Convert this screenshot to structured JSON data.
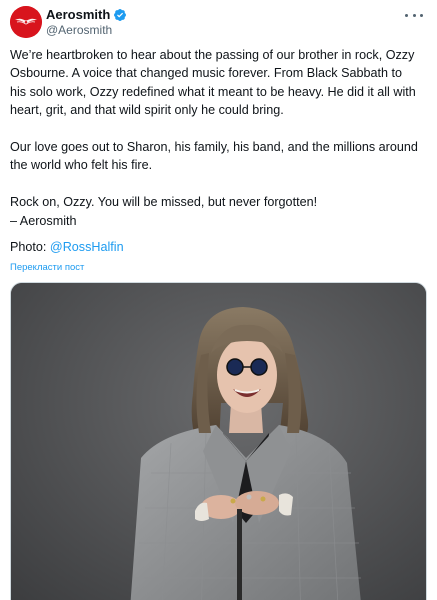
{
  "author": {
    "display_name": "Aerosmith",
    "handle": "@Aerosmith",
    "verified_icon": "verified-badge-icon",
    "avatar_icon": "aerosmith-wings-logo",
    "brand_color": "#d8141d",
    "verified_color": "#1d9bf0"
  },
  "more_icon": "more-dots-icon",
  "post": {
    "para1": [
      "We’re heartbroken to hear about the passing of our brother in rock, Ozzy",
      "Osbourne. A voice that changed music forever. From Black Sabbath to",
      "his solo work, Ozzy redefined what it meant to be heavy. He did it all with",
      "heart, grit, and that wild spirit only he could bring."
    ],
    "para2": [
      "Our love goes out to Sharon, his family, his band, and the millions around",
      "the world who felt his fire."
    ],
    "para3": [
      "Rock on, Ozzy. You will be missed, but never forgotten!",
      "– Aerosmith"
    ],
    "photo_label": "Photo: ",
    "photo_credit": "@RossHalfin",
    "translate_label": "Перекласти пост"
  },
  "media": {
    "description_icon": "portrait-photo",
    "background_color": "#4b4c4e"
  }
}
